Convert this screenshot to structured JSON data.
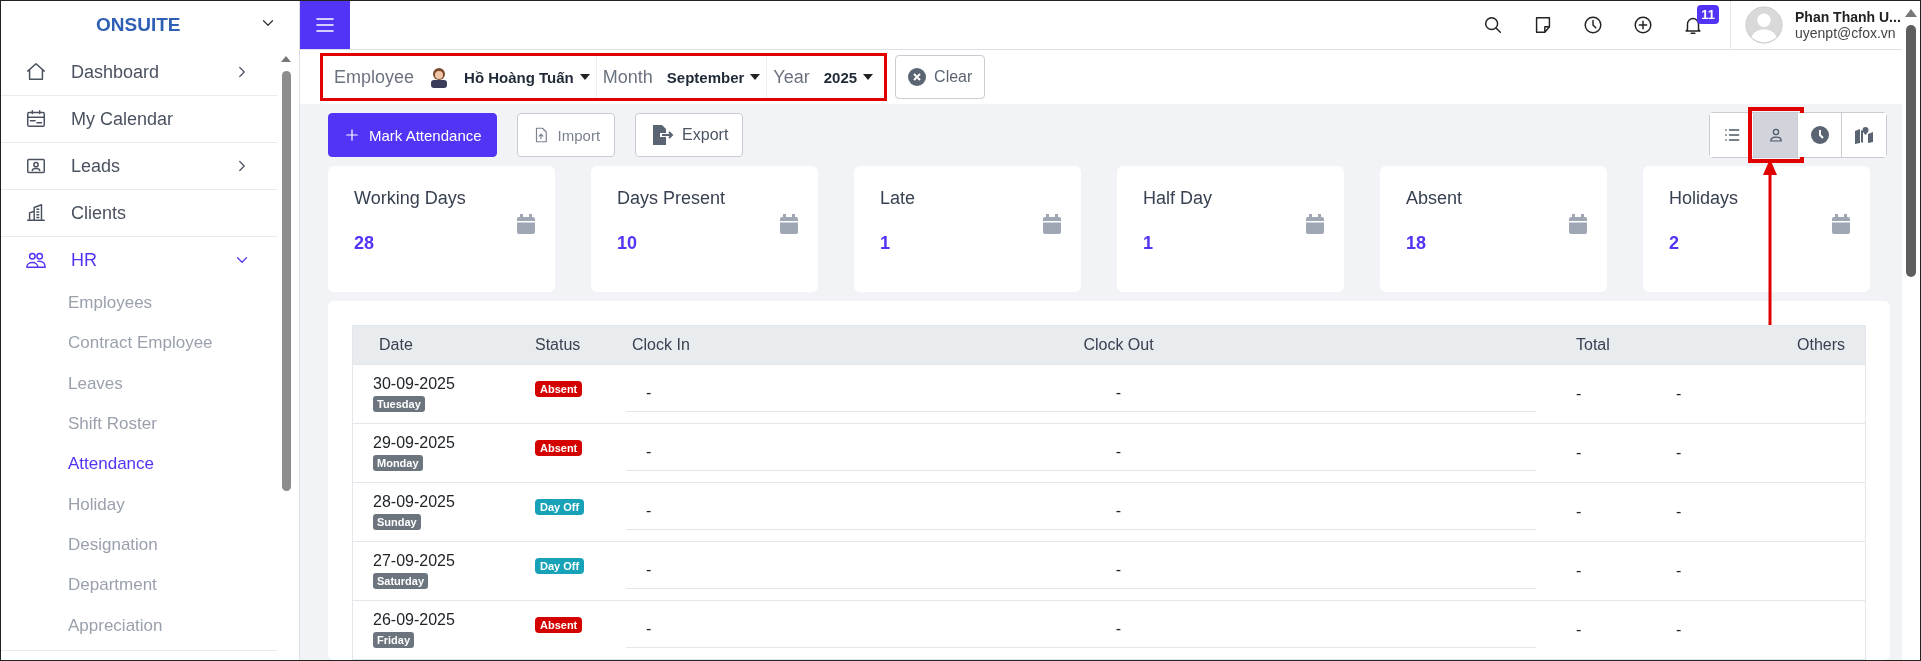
{
  "sidebar": {
    "brand": "ONSUITE",
    "items": [
      {
        "label": "Dashboard",
        "kind": "menu",
        "expanded": false,
        "selected": false
      },
      {
        "label": "My Calendar",
        "kind": "link",
        "selected": false
      },
      {
        "label": "Leads",
        "kind": "menu",
        "expanded": false,
        "selected": false
      },
      {
        "label": "Clients",
        "kind": "link",
        "selected": false
      },
      {
        "label": "HR",
        "kind": "menu",
        "expanded": true,
        "selected": true,
        "children": [
          {
            "label": "Employees",
            "selected": false
          },
          {
            "label": "Contract Employee",
            "selected": false
          },
          {
            "label": "Leaves",
            "selected": false
          },
          {
            "label": "Shift Roster",
            "selected": false
          },
          {
            "label": "Attendance",
            "selected": true
          },
          {
            "label": "Holiday",
            "selected": false
          },
          {
            "label": "Designation",
            "selected": false
          },
          {
            "label": "Department",
            "selected": false
          },
          {
            "label": "Appreciation",
            "selected": false
          }
        ]
      }
    ]
  },
  "header": {
    "notifications": "11",
    "user_name": "Phan Thanh U...",
    "user_email": "uyenpt@cfox.vn"
  },
  "filters": [
    {
      "label": "Employee",
      "value": "Hồ Hoàng Tuấn"
    },
    {
      "label": "Month",
      "value": "September"
    },
    {
      "label": "Year",
      "value": "2025"
    }
  ],
  "clear_button": "Clear",
  "actions": [
    {
      "label": "Mark Attendance",
      "kind": "primary"
    },
    {
      "label": "Import",
      "kind": "import"
    },
    {
      "label": "Export",
      "kind": "export"
    }
  ],
  "view_toggles": [
    {
      "selected": false
    },
    {
      "selected": true
    },
    {
      "selected": false
    },
    {
      "selected": false
    }
  ],
  "stats": [
    {
      "label": "Working Days",
      "value": "28"
    },
    {
      "label": "Days Present",
      "value": "10"
    },
    {
      "label": "Late",
      "value": "1"
    },
    {
      "label": "Half Day",
      "value": "1"
    },
    {
      "label": "Absent",
      "value": "18"
    },
    {
      "label": "Holidays",
      "value": "2"
    }
  ],
  "table": {
    "columns": [
      "Date",
      "Status",
      "Clock In",
      "Clock Out",
      "Total",
      "Others"
    ],
    "rows": [
      {
        "date": "30-09-2025",
        "day": "Tuesday",
        "status": "Absent",
        "color": "#d40000",
        "clock_in": "-",
        "clock_out": "-",
        "total": "-",
        "others": "-"
      },
      {
        "date": "29-09-2025",
        "day": "Monday",
        "status": "Absent",
        "color": "#d40000",
        "clock_in": "-",
        "clock_out": "-",
        "total": "-",
        "others": "-"
      },
      {
        "date": "28-09-2025",
        "day": "Sunday",
        "status": "Day Off",
        "color": "#17a2b8",
        "clock_in": "-",
        "clock_out": "-",
        "total": "-",
        "others": "-"
      },
      {
        "date": "27-09-2025",
        "day": "Saturday",
        "status": "Day Off",
        "color": "#17a2b8",
        "clock_in": "-",
        "clock_out": "-",
        "total": "-",
        "others": "-"
      },
      {
        "date": "26-09-2025",
        "day": "Friday",
        "status": "Absent",
        "color": "#d40000",
        "clock_in": "-",
        "clock_out": "-",
        "total": "-",
        "others": "-"
      }
    ]
  }
}
